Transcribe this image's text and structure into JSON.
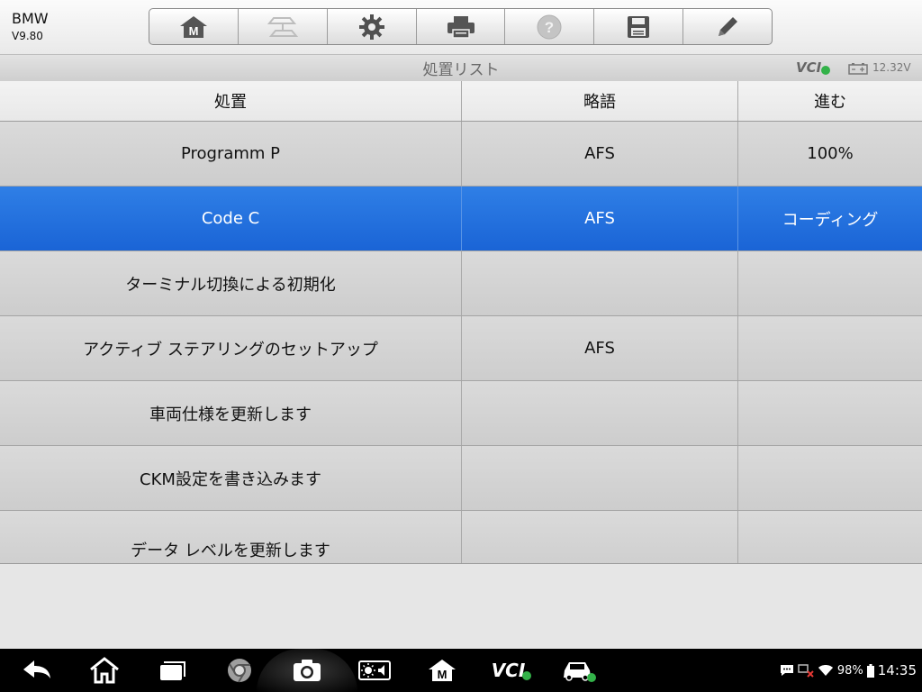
{
  "header": {
    "app_name": "BMW",
    "version": "V9.80"
  },
  "toolbar": {
    "buttons": [
      {
        "icon": "home-m-icon",
        "enabled": true
      },
      {
        "icon": "vehicle-swap-icon",
        "enabled": false
      },
      {
        "icon": "gear-icon",
        "enabled": true
      },
      {
        "icon": "printer-icon",
        "enabled": true
      },
      {
        "icon": "help-icon",
        "enabled": false
      },
      {
        "icon": "save-icon",
        "enabled": true
      },
      {
        "icon": "pencil-icon",
        "enabled": true
      }
    ]
  },
  "titlebar": {
    "title": "処置リスト",
    "vci_label": "VCI",
    "voltage": "12.32V"
  },
  "table": {
    "headers": {
      "action": "処置",
      "abbr": "略語",
      "progress": "進む"
    },
    "rows": [
      {
        "action": "Programm P",
        "abbr": "AFS",
        "progress": "100%"
      },
      {
        "action": "Code C",
        "abbr": "AFS",
        "progress": "コーディング",
        "selected": true
      },
      {
        "action": "ターミナル切換による初期化",
        "abbr": "",
        "progress": ""
      },
      {
        "action": "アクティブ ステアリングのセットアップ",
        "abbr": "AFS",
        "progress": ""
      },
      {
        "action": "車両仕様を更新します",
        "abbr": "",
        "progress": ""
      },
      {
        "action": "CKM設定を書き込みます",
        "abbr": "",
        "progress": ""
      },
      {
        "action": "データ レベルを更新します",
        "abbr": "",
        "progress": ""
      }
    ]
  },
  "navbar": {
    "vci_label": "VCI",
    "battery": "98%",
    "time": "14:35"
  },
  "colors": {
    "selected_row": "#1a64d6",
    "status_ok": "#33b249"
  }
}
